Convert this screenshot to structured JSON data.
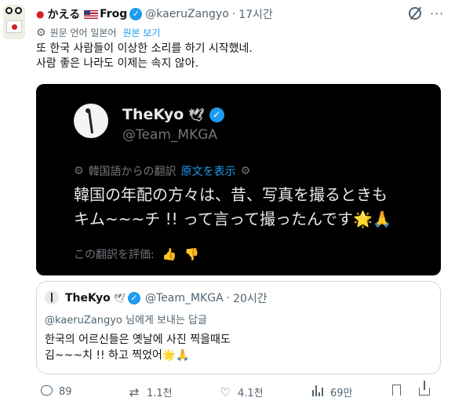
{
  "tweet": {
    "display_name": "かえる",
    "display_name_suffix": "Frog",
    "handle": "@kaeruZangyo",
    "separator": "·",
    "time": "17시간",
    "translation_label": "원문 언어 일본어",
    "show_original": "원본 보기",
    "text_line1": "또 한국 사람들이 이상한 소리를 하기 시작했네.",
    "text_line2": "사람 좋은 나라도 이제는 속지 않아."
  },
  "embedded": {
    "name": "TheKyo",
    "handle": "@Team_MKGA",
    "translation_label": "韓国語からの翻訳",
    "show_original": "原文を表示",
    "body_line1": "韓国の年配の方々は、昔、写真を撮るときも",
    "body_line2": "キム~~~チ !! って言って撮ったんです🌟🙏",
    "rate_label": "この翻訳を評価:"
  },
  "quote": {
    "name": "TheKyo",
    "handle": "@Team_MKGA",
    "separator": "·",
    "time": "20시간",
    "reply_to": "@kaeruZangyo 님에게 보내는 답글",
    "body_line1": "한국의 어르신들은 옛날에 사진 찍을때도",
    "body_line2": "김~~~치 !! 하고 찍었어🌟🙏"
  },
  "actions": {
    "replies": "89",
    "retweets": "1.1천",
    "likes": "4.1천",
    "views": "69만"
  },
  "icons": {
    "verified": "verified-badge-icon",
    "grok": "grok-icon",
    "more": "more-icon",
    "reply": "reply-icon",
    "retweet": "retweet-icon",
    "like": "heart-icon",
    "views": "views-icon",
    "bookmark": "bookmark-icon",
    "share": "share-icon"
  },
  "colors": {
    "accent": "#1d9bf0",
    "muted": "#536471",
    "dark_bg": "#000000"
  }
}
